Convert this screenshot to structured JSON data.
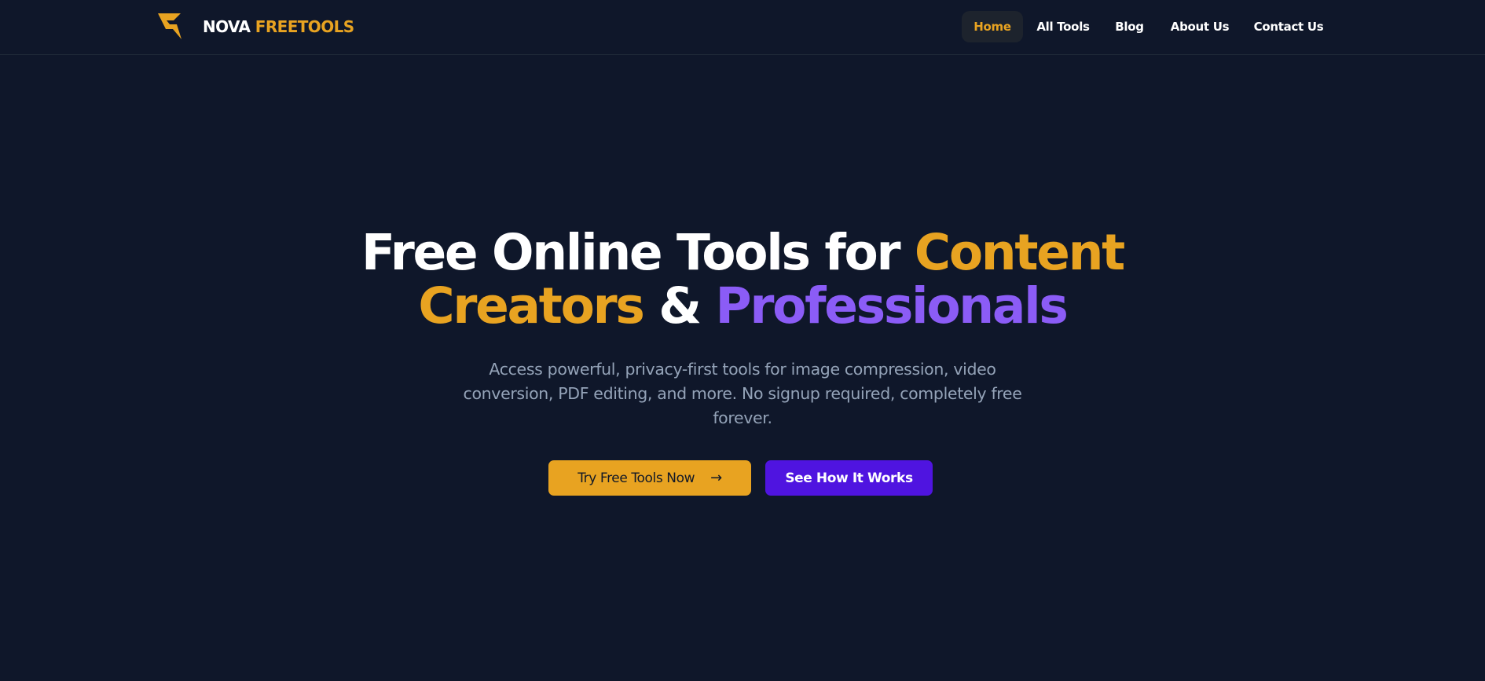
{
  "brand": {
    "name_part1": "NOVA",
    "name_part2": "FREETOOLS",
    "logo_icon": "lightning-logo-icon"
  },
  "nav": {
    "items": [
      {
        "label": "Home",
        "active": true
      },
      {
        "label": "All Tools",
        "active": false
      },
      {
        "label": "Blog",
        "active": false
      },
      {
        "label": "About Us",
        "active": false
      },
      {
        "label": "Contact Us",
        "active": false
      }
    ]
  },
  "hero": {
    "title_part1": "Free Online Tools for",
    "title_highlight1": "Content Creators",
    "title_amp": "&",
    "title_highlight2": "Professionals",
    "description": "Access powerful, privacy-first tools for image compression, video conversion, PDF editing, and more. No signup required, completely free forever.",
    "primary_button": "Try Free Tools Now",
    "primary_button_icon": "arrow-right-icon",
    "secondary_button": "See How It Works"
  },
  "colors": {
    "background": "#0f172a",
    "accent_gold": "#e8a321",
    "accent_purple": "#8b5cf6",
    "button_purple": "#4f14e0",
    "muted_text": "#94a3b8"
  }
}
